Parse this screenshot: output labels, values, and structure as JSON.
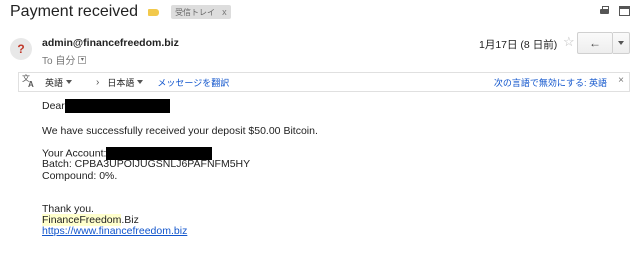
{
  "header": {
    "subject": "Payment received",
    "inbox_chip": "受信トレイ",
    "inbox_chip_close": "x"
  },
  "message": {
    "avatar_glyph": "?",
    "sender": "admin@financefreedom.biz",
    "to": "To 自分",
    "date": "1月17日 (8 日前)",
    "star": "☆",
    "reply_glyph": "←"
  },
  "translate": {
    "source_lang": "英語",
    "chevron": "›",
    "target_lang": "日本語",
    "translate_link": "メッセージを翻訳",
    "disable_text": "次の言語で無効にする: 英語",
    "close": "×"
  },
  "body": {
    "greeting": "Dear",
    "deposit_line": "We have successfully received your deposit $50.00 Bitcoin.",
    "account_label": "Your Account:",
    "batch_line": "Batch: CPBA3UPOIJUGSNLJ6PAFNFM5HY",
    "compound_line": "Compound: 0%.",
    "thanks": "Thank you.",
    "sig_name": "FinanceFreedom",
    "sig_suffix": ".Biz",
    "url": "https://www.financefreedom.biz"
  },
  "colors": {
    "label_tag": "#f2c94c",
    "link": "#1155cc",
    "avatar_mark": "#c0392b"
  }
}
